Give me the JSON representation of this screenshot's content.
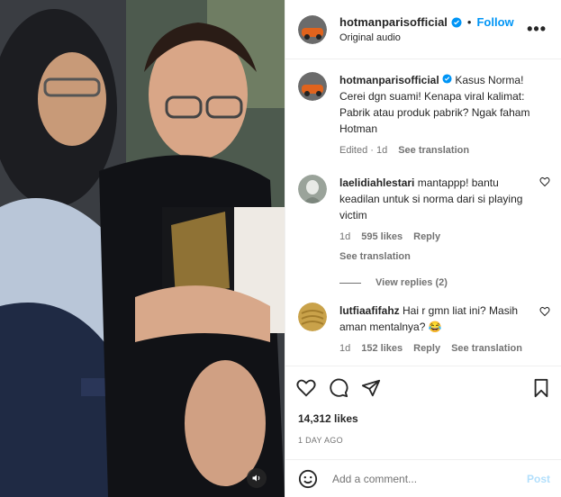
{
  "header": {
    "username": "hotmanparisofficial",
    "follow_label": "Follow",
    "subtitle": "Original audio",
    "more_label": "•••"
  },
  "caption": {
    "username": "hotmanparisofficial",
    "text": "Kasus Norma! Cerei dgn suami! Kenapa viral kalimat: Pabrik atau produk pabrik? Ngak faham Hotman",
    "edited": "Edited · 1d",
    "see_translation": "See translation"
  },
  "comments": [
    {
      "username": "laelidiahlestari",
      "text": "mantappp! bantu keadilan untuk si norma dari si playing victim",
      "time": "1d",
      "likes": "595 likes",
      "reply": "Reply",
      "see_translation": "See translation",
      "view_replies": "View replies (2)"
    },
    {
      "username": "lutfiaafifahz",
      "text": "Hai r gmn liat ini? Masih aman mentalnya? 😂",
      "time": "1d",
      "likes": "152 likes",
      "reply": "Reply",
      "see_translation": "See translation"
    }
  ],
  "post": {
    "likes": "14,312 likes",
    "date": "1 DAY AGO"
  },
  "add_comment": {
    "placeholder": "Add a comment...",
    "post_label": "Post"
  },
  "colors": {
    "accent": "#0095f6",
    "post_disabled": "#b2dffc",
    "muted": "#737373"
  }
}
